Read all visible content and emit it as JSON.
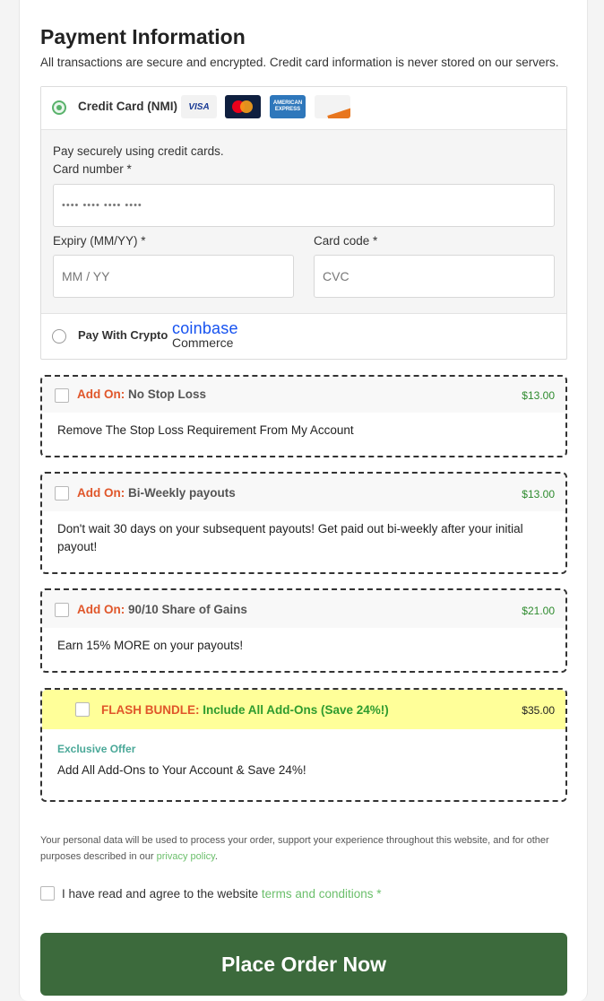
{
  "header": {
    "title": "Payment Information",
    "subtitle": "All transactions are secure and encrypted. Credit card information is never stored on our servers."
  },
  "payment_methods": {
    "credit_card": {
      "label": "Credit Card (NMI)",
      "selected": true,
      "logos": [
        "VISA",
        "mastercard",
        "AMERICAN EXPRESS",
        "DISCOVER"
      ],
      "description": "Pay securely using credit cards.",
      "card_number_label": "Card number *",
      "card_number_placeholder": "•••• •••• •••• ••••",
      "expiry_label": "Expiry (MM/YY) *",
      "expiry_placeholder": "MM / YY",
      "code_label": "Card code *",
      "code_placeholder": "CVC"
    },
    "crypto": {
      "label": "Pay With Crypto",
      "selected": false,
      "brand_line1": "coinbase",
      "brand_line2": "Commerce"
    }
  },
  "addons": [
    {
      "prefix": "Add On:",
      "name": "No Stop Loss",
      "price": "$13.00",
      "description": "Remove The Stop Loss Requirement From My Account"
    },
    {
      "prefix": "Add On:",
      "name": "Bi-Weekly payouts",
      "price": "$13.00",
      "description": "Don't wait 30 days on your subsequent payouts! Get paid out bi-weekly after your initial payout!"
    },
    {
      "prefix": "Add On:",
      "name": "90/10 Share of Gains",
      "price": "$21.00",
      "description": "Earn 15% MORE on your payouts!"
    }
  ],
  "flash_bundle": {
    "prefix": "FLASH BUNDLE:",
    "name": "Include All Add-Ons (Save 24%!)",
    "price": "$35.00",
    "tag": "Exclusive Offer",
    "description": "Add All Add-Ons to Your Account & Save 24%!"
  },
  "privacy": {
    "text": "Your personal data will be used to process your order, support your experience throughout this website, and for other purposes described in our",
    "link": "privacy policy",
    "end": "."
  },
  "terms": {
    "text": "I have read and agree to the website",
    "link": "terms and conditions",
    "required": "*"
  },
  "place_order_label": "Place Order Now",
  "colors": {
    "primary_button": "#3c6a3c",
    "accent_orange": "#e0562a",
    "price_green": "#2e8b2e",
    "flash_bg": "#ffff99"
  }
}
